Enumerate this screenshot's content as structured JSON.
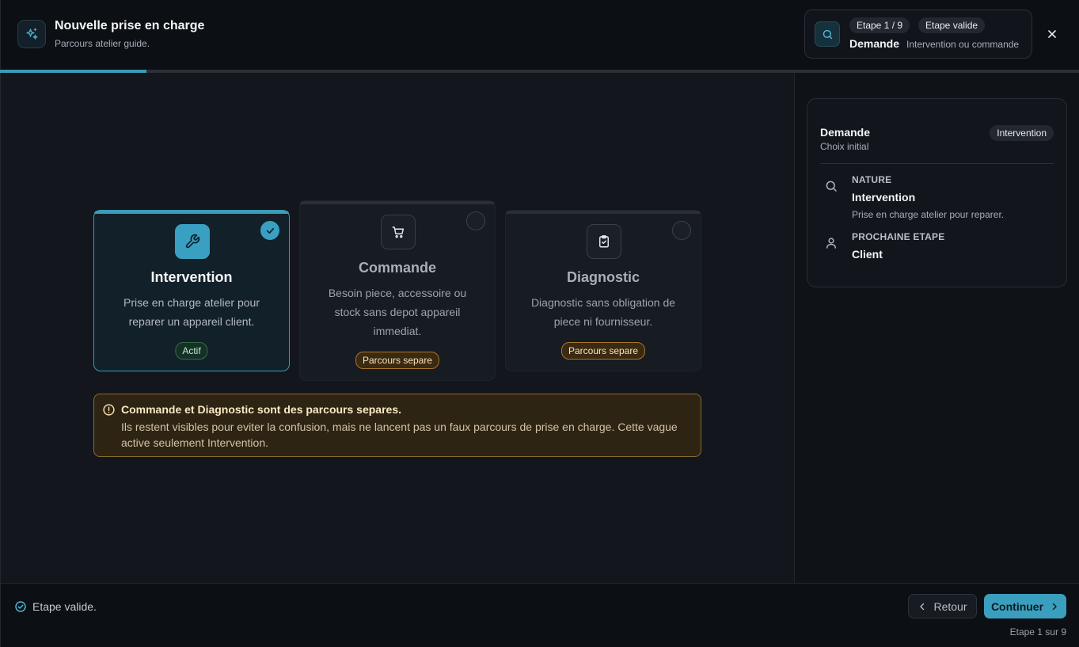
{
  "header": {
    "title": "Nouvelle prise en charge",
    "subtitle": "Parcours atelier guide.",
    "step_pill": "Etape 1 / 9",
    "valid_pill": "Etape valide",
    "step_name": "Demande",
    "step_desc": "Intervention ou commande"
  },
  "progress": {
    "fraction": 0.111,
    "color": "#3b9bb8"
  },
  "cards": [
    {
      "title": "Intervention",
      "text": "Prise en charge atelier pour reparer un appareil client.",
      "badge": "Actif",
      "icon": "wrench-icon",
      "selected": true
    },
    {
      "title": "Commande",
      "text": "Besoin piece, accessoire ou stock sans depot appareil immediat.",
      "badge": "Parcours separe",
      "icon": "cart-icon",
      "selected": false
    },
    {
      "title": "Diagnostic",
      "text": "Diagnostic sans obligation de piece ni fournisseur.",
      "badge": "Parcours separe",
      "icon": "clipboard-check-icon",
      "selected": false
    }
  ],
  "alert": {
    "title": "Commande et Diagnostic sont des parcours separes.",
    "text": "Ils restent visibles pour eviter la confusion, mais ne lancent pas un faux parcours de prise en charge. Cette vague active seulement Intervention."
  },
  "summary": {
    "title": "Demande",
    "subtitle": "Choix initial",
    "pill": "Intervention",
    "nature_label": "NATURE",
    "nature_value": "Intervention",
    "nature_desc": "Prise en charge atelier pour reparer.",
    "next_label": "PROCHAINE ETAPE",
    "next_value": "Client"
  },
  "footer": {
    "status": "Etape valide.",
    "back_label": "Retour",
    "next_label": "Continuer",
    "step_text": "Etape 1 sur 9"
  },
  "colors": {
    "accent": "#3b9bb8",
    "success": "#2d6f4d",
    "warning": "#a8762a"
  }
}
